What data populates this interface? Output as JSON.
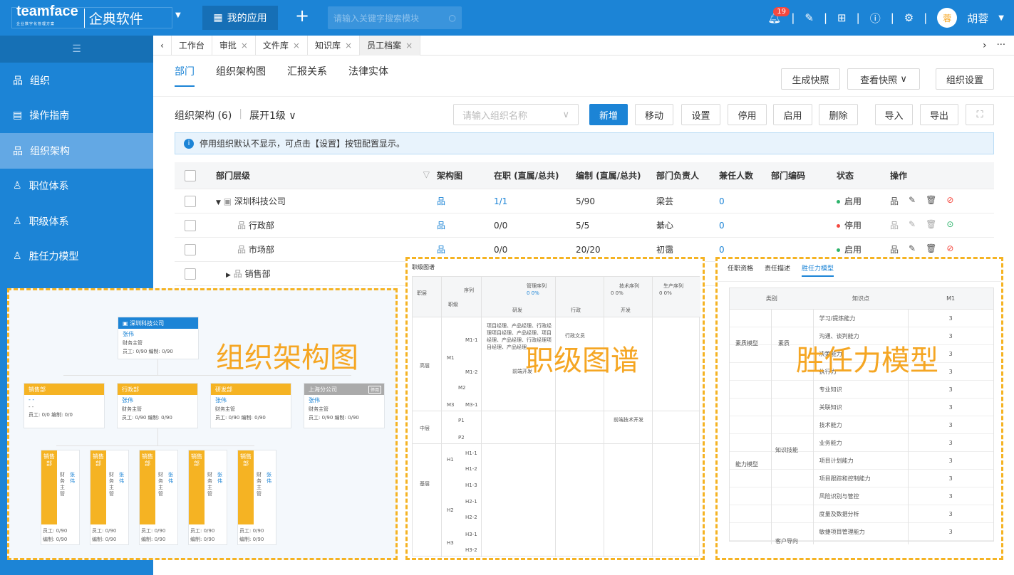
{
  "topbar": {
    "brand": "teamface",
    "brand_sub": "企业数字化管理方案",
    "brand_cn": "企典软件",
    "my_apps": "我的应用",
    "search_placeholder": "请输入关键字搜索模块",
    "notif_count": "19",
    "user_name": "胡蓉",
    "user_initial": "蓉"
  },
  "sidebar": {
    "items": [
      {
        "label": "组织",
        "icon": "org-icon"
      },
      {
        "label": "操作指南",
        "icon": "guide-icon"
      },
      {
        "label": "组织架构",
        "icon": "org-tree-icon"
      },
      {
        "label": "职位体系",
        "icon": "person-icon"
      },
      {
        "label": "职级体系",
        "icon": "person-level-icon"
      },
      {
        "label": "胜任力模型",
        "icon": "person-model-icon"
      }
    ]
  },
  "tabs": [
    "工作台",
    "审批",
    "文件库",
    "知识库",
    "员工档案"
  ],
  "subnav": {
    "items": [
      "部门",
      "组织架构图",
      "汇报关系",
      "法律实体"
    ],
    "snapshot_btn": "生成快照",
    "view_snapshot_btn": "查看快照",
    "org_settings_btn": "组织设置"
  },
  "toolbar": {
    "title": "组织架构 (6)",
    "expand": "展开1级",
    "search_placeholder": "请输入组织名称",
    "add": "新增",
    "move": "移动",
    "settings": "设置",
    "disable": "停用",
    "enable": "启用",
    "delete": "删除",
    "import": "导入",
    "export": "导出"
  },
  "info": "停用组织默认不显示，可点击【设置】按钮配置显示。",
  "table": {
    "headers": [
      "部门层级",
      "架构图",
      "在职 (直属/总共)",
      "编制 (直属/总共)",
      "部门负责人",
      "兼任人数",
      "部门编码",
      "状态",
      "操作"
    ],
    "rows": [
      {
        "name": "深圳科技公司",
        "onjob": "1/1",
        "quota": "5/90",
        "head": "梁芸",
        "concurrent": "0",
        "status": "启用"
      },
      {
        "name": "行政部",
        "onjob": "0/0",
        "quota": "5/5",
        "head": "綦心",
        "concurrent": "0",
        "status": "停用"
      },
      {
        "name": "市场部",
        "onjob": "0/0",
        "quota": "20/20",
        "head": "初霭",
        "concurrent": "0",
        "status": "启用"
      },
      {
        "name": "销售部",
        "onjob": "",
        "quota": "",
        "head": "",
        "concurrent": "",
        "status": ""
      }
    ]
  },
  "overlays": {
    "org_chart": "组织架构图",
    "level_map": "职级图谱",
    "competency": "胜任力模型"
  },
  "org_chart": {
    "root": {
      "title": "深圳科技公司",
      "person": "张伟",
      "role": "财务主管",
      "stat": "员工: 0/90  编制: 0/90"
    },
    "children": [
      {
        "title": "销售部",
        "person": "- -",
        "role": "- -",
        "stat": "员工: 0/0  编制: 0/0"
      },
      {
        "title": "行政部",
        "person": "张伟",
        "role": "财务主管",
        "stat": "员工: 0/90  编制: 0/90"
      },
      {
        "title": "研发部",
        "person": "张伟",
        "role": "财务主管",
        "stat": "员工: 0/90  编制: 0/90"
      },
      {
        "title": "上海分公司",
        "person": "张伟",
        "role": "财务主管",
        "stat": "员工: 0/90  编制: 0/90",
        "tag": "停用"
      }
    ],
    "leaf_title": "销售部",
    "leaf_role": "财务主管",
    "leaf_person": "张伟",
    "leaf_stat1": "员工: 0/90",
    "leaf_stat2": "编制: 0/90"
  },
  "level_map": {
    "title": "职级图谱",
    "h_level": "职层",
    "h_seq": "序列",
    "h_grade": "职级",
    "mgmt": "管理序列",
    "tech": "技术序列",
    "prod": "生产序列",
    "cnt": "0  0%",
    "cols": [
      "研发",
      "行政",
      "开发"
    ],
    "cell1": "项目经理、产品经理、行政经理项目经理、产品经理、项目经理、产品经理、行政经理项目经理、产品经理",
    "cell2": "行政文员",
    "cell3": "前端开发",
    "cell4": "前端技术开发",
    "layers": [
      "高层",
      "中层",
      "基层"
    ],
    "grades": [
      "M1",
      "M2",
      "M3",
      "P1",
      "P2",
      "H1",
      "H2",
      "H3"
    ],
    "subs": [
      "M1-1",
      "M1-2",
      "M3-1",
      "H1-1",
      "H1-2",
      "H1-3",
      "H2-1",
      "H2-2",
      "H3-1",
      "H3-2"
    ]
  },
  "competency": {
    "tabs": [
      "任职资格",
      "责任描述",
      "胜任力模型"
    ],
    "headers": [
      "类别",
      "知识点",
      "M1"
    ],
    "groups": [
      {
        "cat": "素质模型",
        "sub": "素质"
      },
      {
        "cat": "能力模型",
        "sub": "知识技能"
      }
    ],
    "sub3": "客户导向",
    "items": [
      [
        "学习/提炼能力",
        "3"
      ],
      [
        "沟通、谈判能力",
        "3"
      ],
      [
        "决策能力",
        "3"
      ],
      [
        "执行力",
        "3"
      ],
      [
        "专业知识",
        "3"
      ],
      [
        "关联知识",
        "3"
      ],
      [
        "技术能力",
        "3"
      ],
      [
        "业务能力",
        "3"
      ],
      [
        "项目计划能力",
        "3"
      ],
      [
        "项目跟踪和控制能力",
        "3"
      ],
      [
        "风险识别与管控",
        "3"
      ],
      [
        "度量及数据分析",
        "3"
      ],
      [
        "敏捷项目管理能力",
        "3"
      ]
    ]
  }
}
